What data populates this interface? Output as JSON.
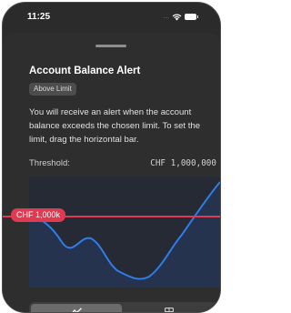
{
  "status_bar": {
    "time": "11:25",
    "signal": "....",
    "icons": [
      "wifi-icon",
      "battery-icon"
    ]
  },
  "sheet": {
    "title": "Account Balance Alert",
    "badge": "Above Limit",
    "description": "You will receive an alert when the account balance exceeds the chosen limit. To set the limit, drag the horizontal bar.",
    "threshold_label": "Threshold:",
    "threshold_value": "CHF 1,000,000",
    "limit_marker_label": "CHF 1,000k"
  },
  "view_toggle": {
    "options": [
      {
        "icon": "line-chart-icon",
        "selected": true
      },
      {
        "icon": "table-icon",
        "selected": false
      }
    ]
  },
  "colors": {
    "accent": "#e03a52",
    "curve": "#2f7de8",
    "background": "#2e2e2e"
  }
}
